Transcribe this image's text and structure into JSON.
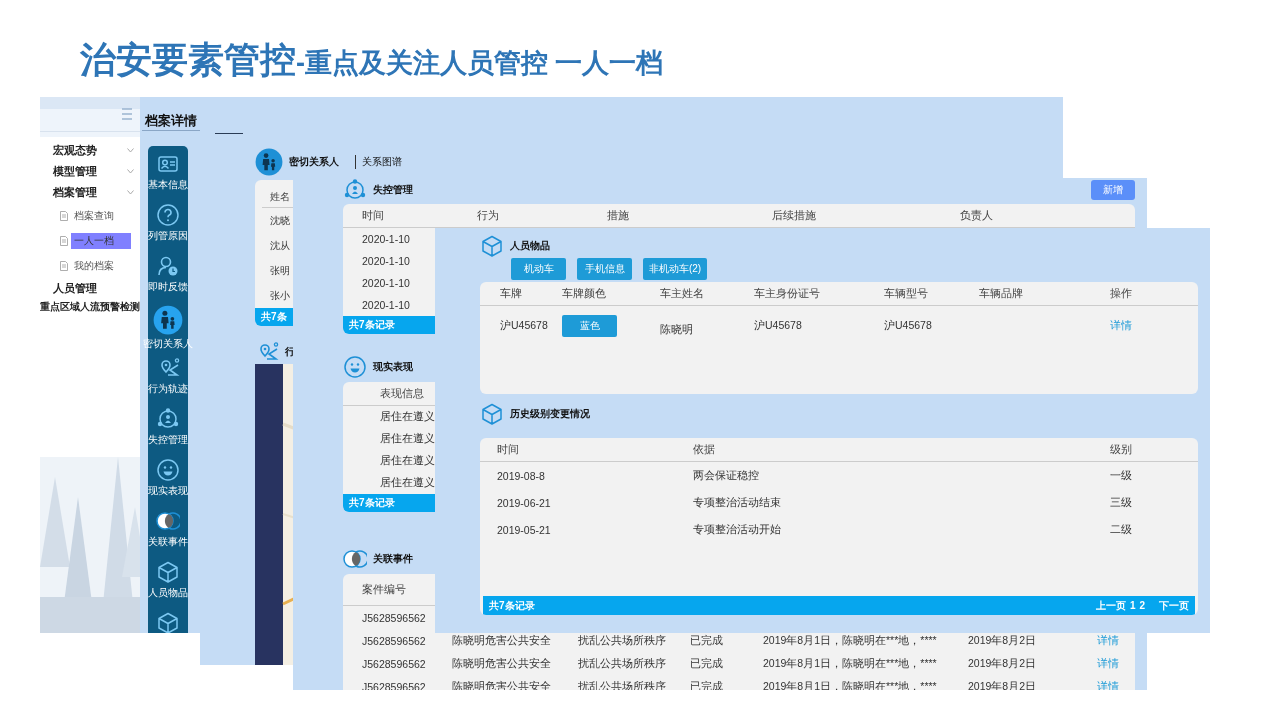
{
  "title": {
    "main": "治安要素管控",
    "sub": "-重点及关注人员管控 一人一档"
  },
  "menu_panel": {
    "items": [
      {
        "label": "宏观态势",
        "expandable": true
      },
      {
        "label": "模型管理",
        "expandable": true
      },
      {
        "label": "档案管理",
        "expandable": true,
        "children": [
          {
            "label": "档案查询",
            "selected": false
          },
          {
            "label": "一人一档",
            "selected": true
          },
          {
            "label": "我的档案",
            "selected": false
          }
        ]
      },
      {
        "label": "人员管理",
        "expandable": false
      },
      {
        "label": "重点区域人流预警检测",
        "expandable": false
      }
    ]
  },
  "detail_title": "档案详情",
  "nav": [
    {
      "label": "基本信息",
      "selected": false
    },
    {
      "label": "列管原因",
      "selected": false
    },
    {
      "label": "即时反馈",
      "selected": false
    },
    {
      "label": "密切关系人",
      "selected": true
    },
    {
      "label": "行为轨迹",
      "selected": false
    },
    {
      "label": "失控管理",
      "selected": false
    },
    {
      "label": "现实表现",
      "selected": false
    },
    {
      "label": "关联事件",
      "selected": false
    },
    {
      "label": "人员物品",
      "selected": false
    }
  ],
  "contacts": {
    "title": "密切关系人",
    "tab": "关系图谱",
    "column": "姓名",
    "rows": [
      "沈晓",
      "沈从",
      "张明",
      "张小"
    ],
    "footer": "共7条"
  },
  "track": {
    "title": "行"
  },
  "control": {
    "title": "失控管理",
    "add_button": "新增",
    "columns": [
      "时间",
      "行为",
      "措施",
      "后续措施",
      "负责人"
    ],
    "rows": [
      [
        "2020-1-10"
      ],
      [
        "2020-1-10"
      ],
      [
        "2020-1-10"
      ],
      [
        "2020-1-10"
      ]
    ],
    "footer": "共7条记录"
  },
  "behavior": {
    "title": "现实表现",
    "columns": [
      "表现信息"
    ],
    "rows": [
      [
        "居住在遵义"
      ],
      [
        "居住在遵义"
      ],
      [
        "居住在遵义"
      ],
      [
        "居住在遵义"
      ]
    ],
    "footer": "共7条记录"
  },
  "events": {
    "title": "关联事件",
    "columns": [
      "案件编号"
    ],
    "rows": [
      [
        "J5628596562"
      ],
      [
        "J5628596562",
        "陈晓明危害公共安全",
        "扰乱公共场所秩序",
        "已完成",
        "2019年8月1日，陈晓明在***地，****",
        "2019年8月2日",
        "详情"
      ],
      [
        "J5628596562",
        "陈晓明危害公共安全",
        "扰乱公共场所秩序",
        "已完成",
        "2019年8月1日，陈晓明在***地，****",
        "2019年8月2日",
        "详情"
      ],
      [
        "J5628596562",
        "陈晓明危害公共安全",
        "扰乱公共场所秩序",
        "已完成",
        "2019年8月1日，陈晓明在***地，****",
        "2019年8月2日",
        "详情"
      ]
    ]
  },
  "belongings": {
    "title": "人员物品",
    "tabs": [
      "机动车",
      "手机信息",
      "非机动车(2)"
    ],
    "columns": [
      "车牌",
      "车牌颜色",
      "车主姓名",
      "车主身份证号",
      "车辆型号",
      "车辆品牌",
      "操作"
    ],
    "rows": [
      {
        "plate": "沪U45678",
        "plate_color": "蓝色",
        "owner": "陈晓明",
        "owner_id": "沪U45678",
        "model": "沪U45678",
        "action": "详情"
      }
    ]
  },
  "history": {
    "title": "历史级别变更情况",
    "columns": [
      "时间",
      "依据",
      "级别"
    ],
    "rows": [
      [
        "2019-08-8",
        "两会保证稳控",
        "一级"
      ],
      [
        "2019-06-21",
        "专项整治活动结束",
        "三级"
      ],
      [
        "2019-05-21",
        "专项整治活动开始",
        "二级"
      ]
    ],
    "footer": "共7条记录",
    "pager": {
      "prev": "上一页",
      "pages": [
        "1",
        "2"
      ],
      "next": "下一页"
    }
  }
}
